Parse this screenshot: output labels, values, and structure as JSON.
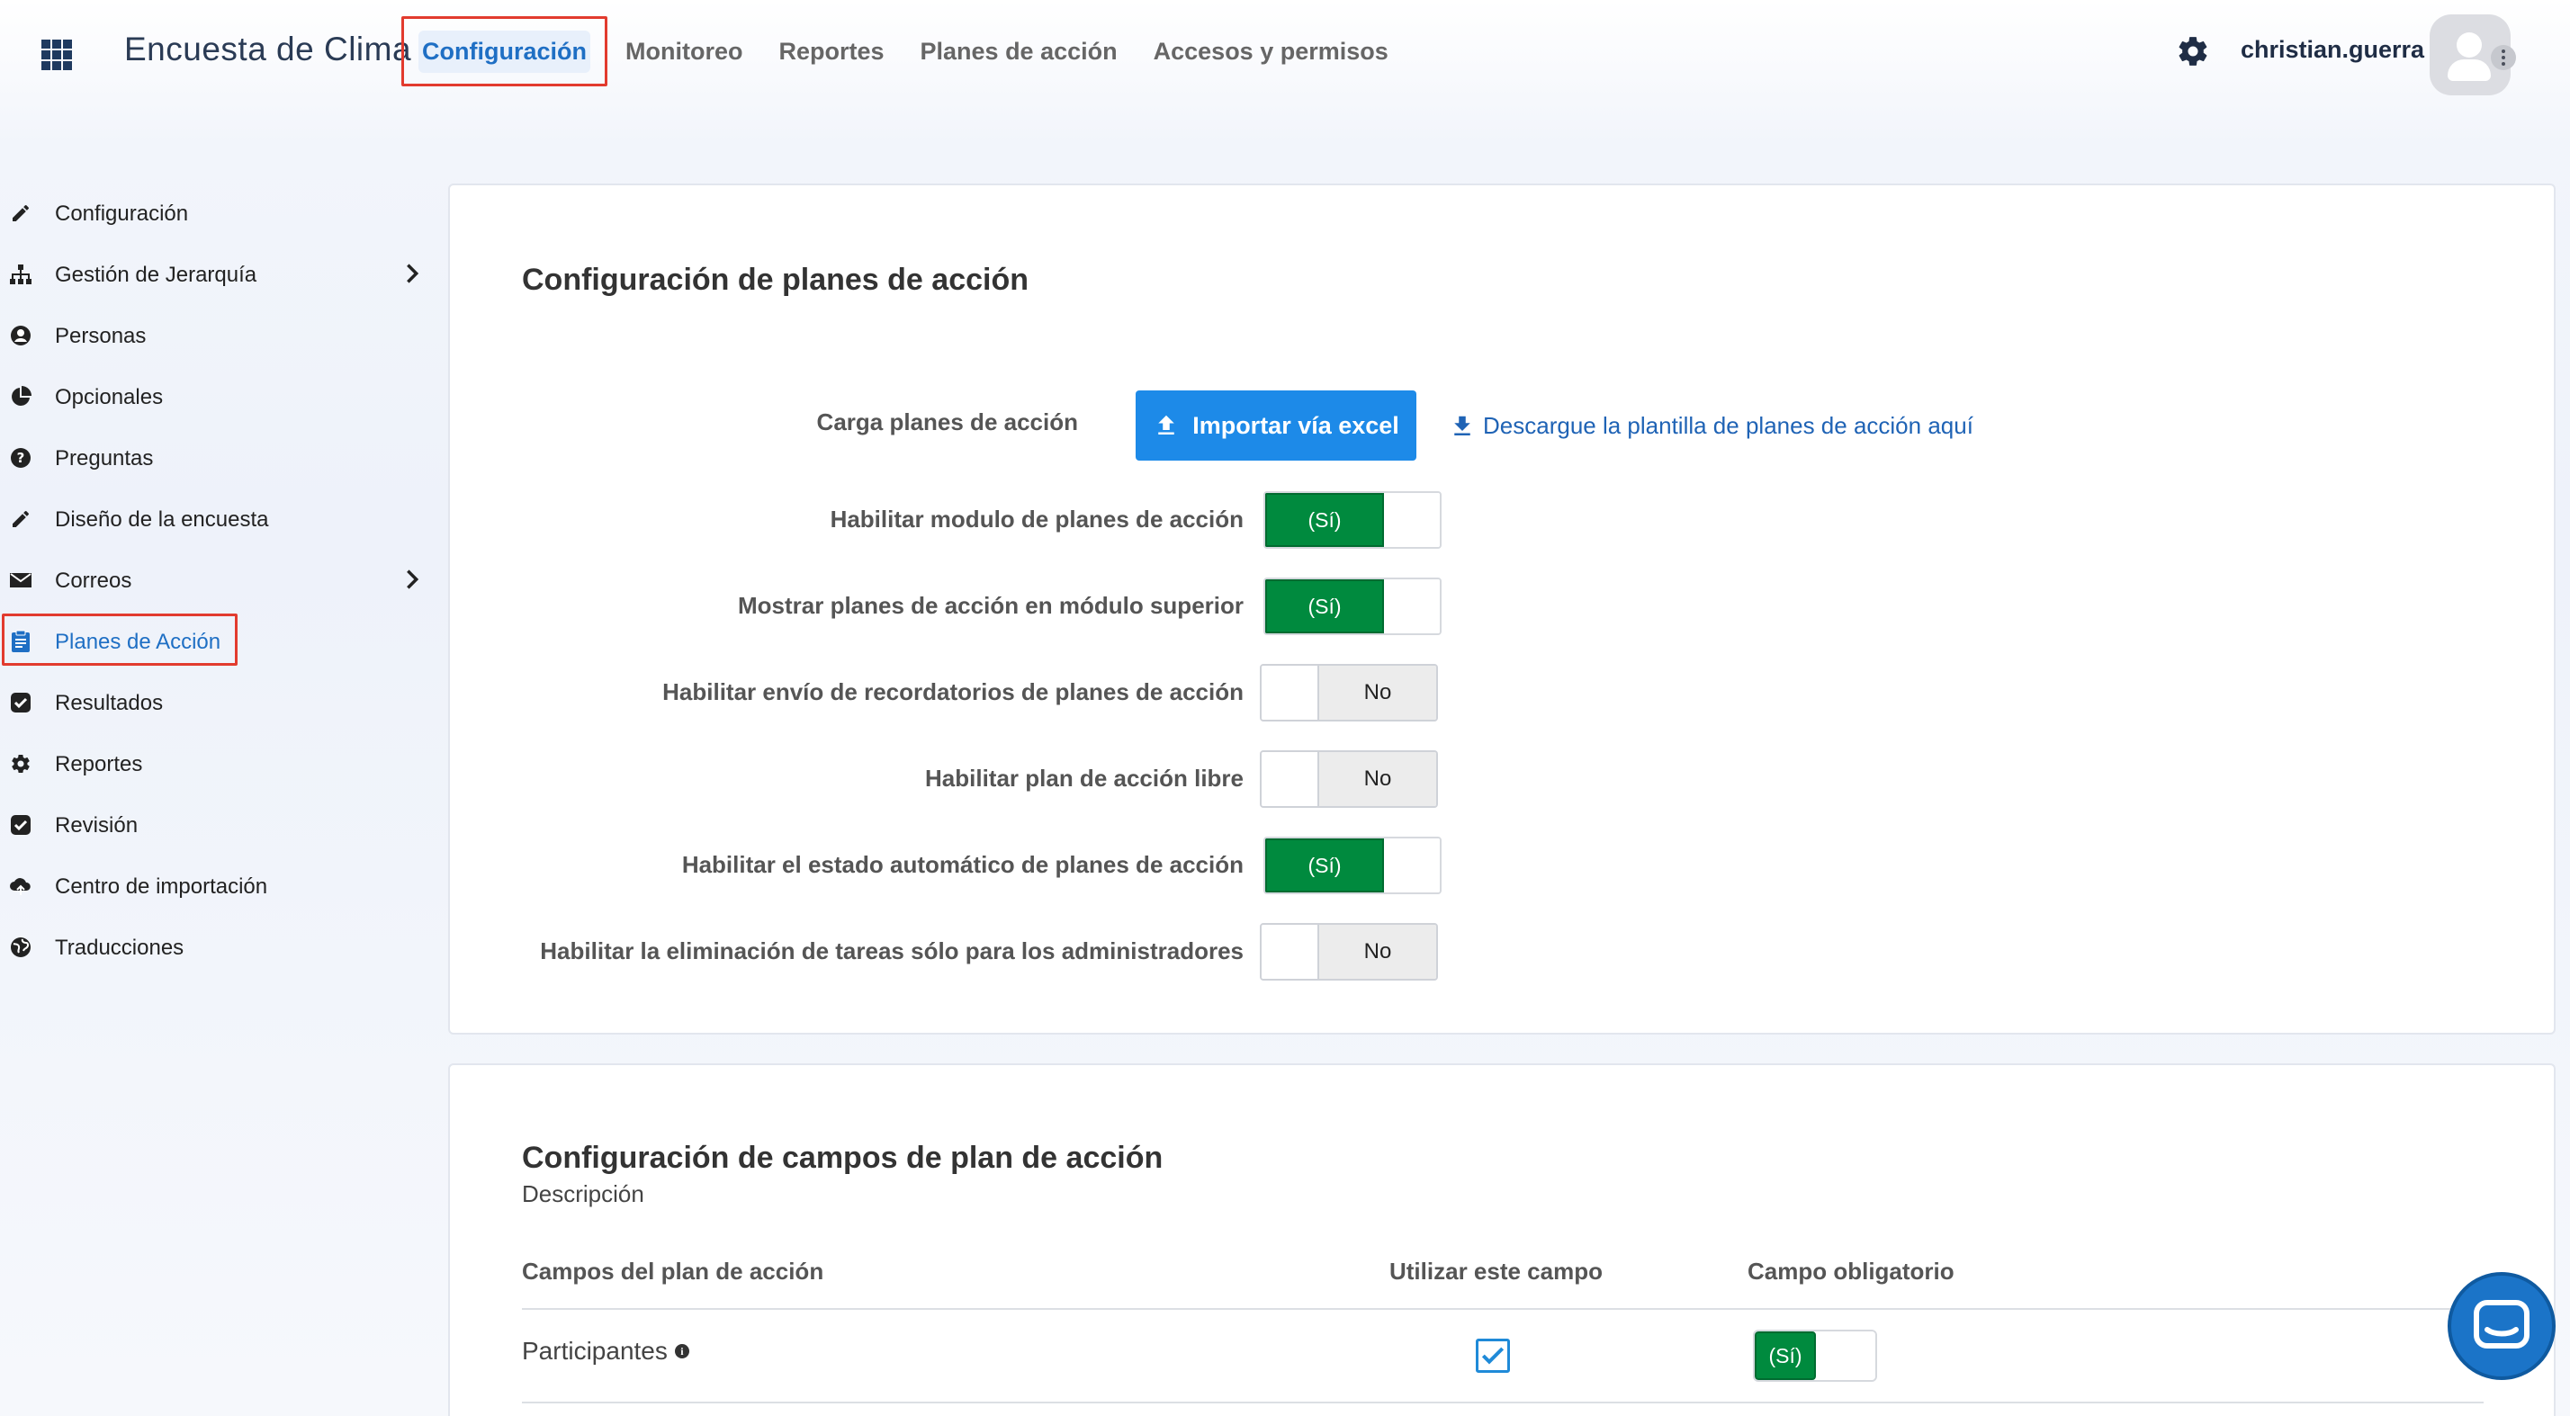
{
  "app": {
    "title": "Encuesta de Clima"
  },
  "topnav": {
    "items": [
      {
        "label": "Configuración",
        "active": true
      },
      {
        "label": "Monitoreo"
      },
      {
        "label": "Reportes"
      },
      {
        "label": "Planes de acción"
      },
      {
        "label": "Accesos y permisos"
      }
    ]
  },
  "user": {
    "name": "christian.guerra"
  },
  "sidebar": {
    "items": [
      {
        "label": "Configuración",
        "icon": "pencil-icon"
      },
      {
        "label": "Gestión de Jerarquía",
        "icon": "sitemap-icon",
        "has_children": true
      },
      {
        "label": "Personas",
        "icon": "person-icon"
      },
      {
        "label": "Opcionales",
        "icon": "pie-chart-icon"
      },
      {
        "label": "Preguntas",
        "icon": "question-icon"
      },
      {
        "label": "Diseño de la encuesta",
        "icon": "pencil-icon"
      },
      {
        "label": "Correos",
        "icon": "envelope-icon",
        "has_children": true
      },
      {
        "label": "Planes de Acción",
        "icon": "clipboard-icon",
        "active": true
      },
      {
        "label": "Resultados",
        "icon": "check-square-icon"
      },
      {
        "label": "Reportes",
        "icon": "gear-icon"
      },
      {
        "label": "Revisión",
        "icon": "check-square-icon"
      },
      {
        "label": "Centro de importación",
        "icon": "cloud-upload-icon"
      },
      {
        "label": "Traducciones",
        "icon": "globe-icon"
      }
    ]
  },
  "card1": {
    "title": "Configuración de planes de acción",
    "upload_label": "Carga planes de acción",
    "import_button": "Importar vía excel",
    "download_link": "Descargue la plantilla de planes de acción aquí",
    "settings": [
      {
        "label": "Habilitar modulo de planes de acción",
        "state": "(Sí)",
        "on": true
      },
      {
        "label": "Mostrar planes de acción en módulo superior",
        "state": "(Sí)",
        "on": true
      },
      {
        "label": "Habilitar envío de recordatorios de planes de acción",
        "state": "No",
        "on": false
      },
      {
        "label": "Habilitar plan de acción libre",
        "state": "No",
        "on": false
      },
      {
        "label": "Habilitar el estado automático de planes de acción",
        "state": "(Sí)",
        "on": true
      },
      {
        "label": "Habilitar la eliminación de tareas sólo para los administradores",
        "state": "No",
        "on": false
      }
    ]
  },
  "card2": {
    "title": "Configuración de campos de plan de acción",
    "description": "Descripción",
    "columns": [
      "Campos del plan de acción",
      "Utilizar este campo",
      "Campo obligatorio"
    ],
    "rows": [
      {
        "field": "Participantes",
        "use": true,
        "required_state": "(Sí)"
      }
    ]
  },
  "colors": {
    "accent": "#1d8ae8",
    "toggle_on": "#008a3e",
    "highlight": "#e23b2e"
  }
}
